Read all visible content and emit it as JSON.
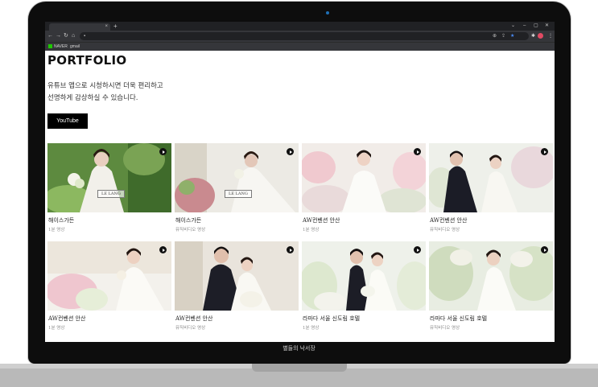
{
  "browser": {
    "tab_close": "×",
    "new_tab": "+",
    "window_controls": [
      "⌄",
      "–",
      "▢",
      "✕"
    ],
    "nav_icons": [
      "←",
      "→",
      "↻",
      "⌂"
    ],
    "bookmarks": [
      "NAVER",
      "gmail"
    ]
  },
  "page": {
    "title": "PORTFOLIO",
    "description_lines": [
      "유튜브 앱으로 시청하시면 더욱 편리하고",
      "선명하게 감상하실 수 있습니다."
    ],
    "youtube_button": "YouTube"
  },
  "videos": [
    {
      "name": "해이스가든",
      "sub": "1분 영상",
      "watermark": "LE LANG"
    },
    {
      "name": "해이스가든",
      "sub": "뮤직비디오 영상",
      "watermark": "LE LANG"
    },
    {
      "name": "AW컨벤션 안산",
      "sub": "1분 영상"
    },
    {
      "name": "AW컨벤션 안산",
      "sub": "뮤직비디오 영상"
    },
    {
      "name": "AW컨벤션 안산",
      "sub": "1분 영상"
    },
    {
      "name": "AW컨벤션 안산",
      "sub": "뮤직비디오 영상"
    },
    {
      "name": "라마다 서울 신도림 호텔",
      "sub": "1분 영상"
    },
    {
      "name": "라마다 서울 신도림 호텔",
      "sub": "뮤직비디오 영상"
    }
  ],
  "footer": {
    "caption": "별들의 낙서장"
  },
  "colors": {
    "bezel": "#0d0d0d",
    "button_bg": "#000000",
    "chrome_bg": "#202124"
  }
}
